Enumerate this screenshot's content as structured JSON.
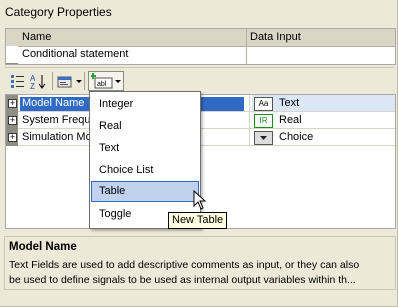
{
  "panel": {
    "title": "Category Properties"
  },
  "category_grid": {
    "headers": [
      "Name",
      "Data Input"
    ],
    "rows": [
      {
        "name": "Conditional statement",
        "value": ""
      }
    ]
  },
  "toolbar": {
    "buttons": [
      {
        "name": "categorized-view-icon"
      },
      {
        "name": "sort-az-icon"
      },
      {
        "name": "property-pages-icon"
      },
      {
        "name": "add-property-icon",
        "label": "abl"
      }
    ]
  },
  "properties": {
    "rows": [
      {
        "name": "Model Name",
        "chip": "Aa",
        "value": "Text",
        "selected": true
      },
      {
        "name": "System Frequ",
        "chip": "IR",
        "value": "Real",
        "selected": false
      },
      {
        "name": "Simulation Mo",
        "chip": "",
        "value": "Choice",
        "selected": false
      }
    ]
  },
  "menu": {
    "items": [
      "Integer",
      "Real",
      "Text",
      "Choice List",
      "Table",
      "Toggle"
    ],
    "highlighted": "Table"
  },
  "tooltip": "New Table",
  "description": {
    "title": "Model Name",
    "text": "Text Fields are used to add descriptive comments as input, or they can also\nbe used to define signals to be used as internal output variables within th..."
  },
  "colors": {
    "selection": "#316ac5",
    "menu_highlight": "#c1d2ee",
    "background": "#ece9d8"
  }
}
